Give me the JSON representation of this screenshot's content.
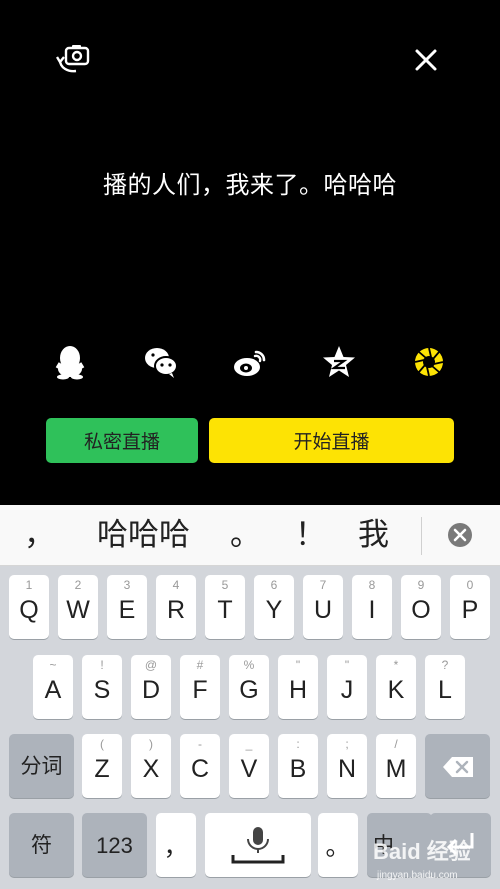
{
  "live": {
    "title_text": "播的人们，我来了。哈哈哈",
    "private_button": "私密直播",
    "start_button": "开始直播",
    "share_icons": [
      "qq-icon",
      "wechat-icon",
      "weibo-icon",
      "qzone-icon",
      "lens-icon"
    ]
  },
  "candidates": {
    "items": [
      "，",
      "哈哈哈",
      "。",
      "！",
      "我"
    ]
  },
  "keyboard": {
    "row1": [
      {
        "main": "Q",
        "sub": "1"
      },
      {
        "main": "W",
        "sub": "2"
      },
      {
        "main": "E",
        "sub": "3"
      },
      {
        "main": "R",
        "sub": "4"
      },
      {
        "main": "T",
        "sub": "5"
      },
      {
        "main": "Y",
        "sub": "6"
      },
      {
        "main": "U",
        "sub": "7"
      },
      {
        "main": "I",
        "sub": "8"
      },
      {
        "main": "O",
        "sub": "9"
      },
      {
        "main": "P",
        "sub": "0"
      }
    ],
    "row2": [
      {
        "main": "A",
        "sub": "~"
      },
      {
        "main": "S",
        "sub": "!"
      },
      {
        "main": "D",
        "sub": "@"
      },
      {
        "main": "F",
        "sub": "#"
      },
      {
        "main": "G",
        "sub": "%"
      },
      {
        "main": "H",
        "sub": "\""
      },
      {
        "main": "J",
        "sub": "\""
      },
      {
        "main": "K",
        "sub": "*"
      },
      {
        "main": "L",
        "sub": "?"
      }
    ],
    "row3": [
      {
        "main": "Z",
        "sub": "("
      },
      {
        "main": "X",
        "sub": ")"
      },
      {
        "main": "C",
        "sub": "-"
      },
      {
        "main": "V",
        "sub": "_"
      },
      {
        "main": "B",
        "sub": ":"
      },
      {
        "main": "N",
        "sub": ";"
      },
      {
        "main": "M",
        "sub": "/"
      }
    ],
    "fenci": "分词",
    "fu": "符",
    "num": "123",
    "comma": "，",
    "period": "。",
    "zhong": "中"
  },
  "watermark": {
    "main": "Baid 经验",
    "sub": "jingyan.baidu.com"
  },
  "colors": {
    "private": "#2fc15a",
    "start": "#fde304",
    "lens": "#fde304"
  }
}
